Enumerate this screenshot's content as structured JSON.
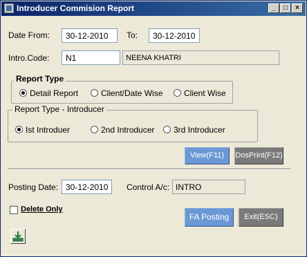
{
  "window": {
    "title": "Introducer Commision Report",
    "controls": [
      "_",
      "□",
      "×"
    ]
  },
  "form": {
    "date_from_label": "Date From:",
    "date_from_value": "30-12-2010",
    "to_label": "To:",
    "to_value": "30-12-2010",
    "intro_code_label": "Intro.Code:",
    "intro_code_value": "N1",
    "intro_name_value": "NEENA KHATRI"
  },
  "report_type": {
    "legend": "Report Type",
    "options": [
      "Detail Report",
      "Client/Date Wise",
      "Client Wise"
    ],
    "selected": "Detail Report"
  },
  "report_type_introducer": {
    "legend": "Report Type - Introducer",
    "options": [
      "Ist Introduer",
      "2nd Introducer",
      "3rd Introducer"
    ],
    "selected": "Ist Introduer"
  },
  "buttons": {
    "view": "View(F11)",
    "dosprint": "DosPrint(F12)",
    "fa_posting": "FA Posting",
    "exit": "Exit(ESC)"
  },
  "posting": {
    "posting_date_label": "Posting Date:",
    "posting_date_value": "30-12-2010",
    "control_ac_label": "Control A/c:",
    "control_ac_value": "INTRO"
  },
  "delete_only": {
    "label": "Delete Only",
    "checked": false
  },
  "icons": {
    "title_icon": "app-icon",
    "download_icon": "download-icon"
  }
}
